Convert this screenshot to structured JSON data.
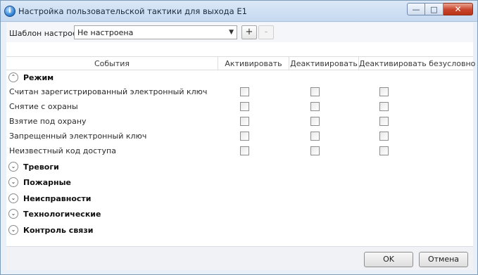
{
  "window": {
    "title": "Настройка пользовательской тактики для выхода Е1",
    "controls": {
      "minimize": "minimize-icon",
      "maximize": "maximize-icon",
      "close": "close-icon"
    }
  },
  "toolbar": {
    "template_label": "Шаблон настроек",
    "template_value": "Не настроена",
    "add_label": "+",
    "remove_label": "-"
  },
  "grid": {
    "columns": [
      "События",
      "Активировать",
      "Деактивировать",
      "Деактивировать безусловно"
    ],
    "expanded_group": {
      "label": "Режим",
      "events": [
        {
          "label": "Считан зарегистрированный электронный ключ",
          "activate": false,
          "deactivate": false,
          "deactivate_unconditional": false
        },
        {
          "label": "Снятие с охраны",
          "activate": false,
          "deactivate": false,
          "deactivate_unconditional": false
        },
        {
          "label": "Взятие под охрану",
          "activate": false,
          "deactivate": false,
          "deactivate_unconditional": false
        },
        {
          "label": "Запрещенный электронный ключ",
          "activate": false,
          "deactivate": false,
          "deactivate_unconditional": false
        },
        {
          "label": "Неизвестный код доступа",
          "activate": false,
          "deactivate": false,
          "deactivate_unconditional": false
        }
      ]
    },
    "collapsed_groups": [
      "Тревоги",
      "Пожарные",
      "Неисправности",
      "Технологические",
      "Контроль связи"
    ]
  },
  "footer": {
    "ok_label": "OK",
    "cancel_label": "Отмена"
  }
}
